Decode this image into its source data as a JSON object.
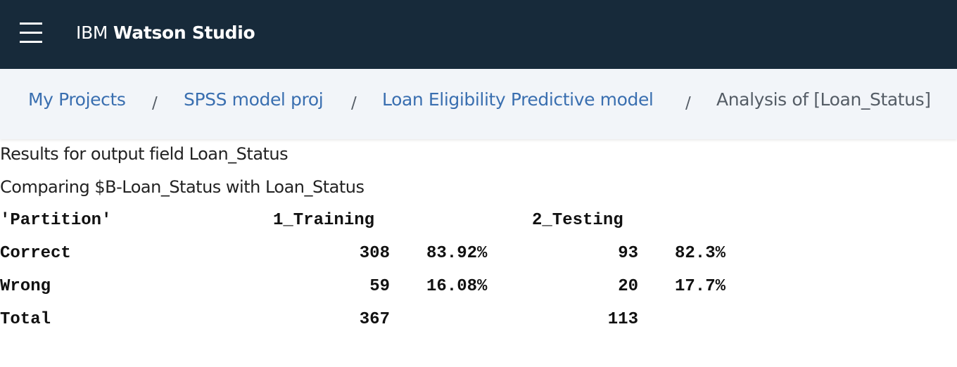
{
  "header": {
    "brand_prefix": "IBM",
    "brand_name": "Watson Studio",
    "menu_icon": "hamburger-menu-icon",
    "background": "#172a3a"
  },
  "breadcrumb": {
    "items": [
      {
        "label": "My Projects"
      },
      {
        "label": "SPSS model proj"
      },
      {
        "label": "Loan Eligibility Predictive model"
      },
      {
        "label": "Analysis of [Loan_Status]"
      }
    ],
    "separator": "/",
    "link_color": "#3a6fb0",
    "background": "#f2f5f9"
  },
  "analysis": {
    "title": "Results for output field Loan_Status",
    "subtitle": "Comparing $B-Loan_Status with Loan_Status",
    "table": {
      "header_label": "'Partition'",
      "partitions": [
        "1_Training",
        "2_Testing"
      ],
      "rows": [
        {
          "label": "Correct",
          "training_count": "308",
          "training_pct": "83.92%",
          "testing_count": "93",
          "testing_pct": "82.3%"
        },
        {
          "label": "Wrong",
          "training_count": "59",
          "training_pct": "16.08%",
          "testing_count": "20",
          "testing_pct": "17.7%"
        },
        {
          "label": "Total",
          "training_count": "367",
          "training_pct": "",
          "testing_count": "113",
          "testing_pct": ""
        }
      ]
    }
  }
}
